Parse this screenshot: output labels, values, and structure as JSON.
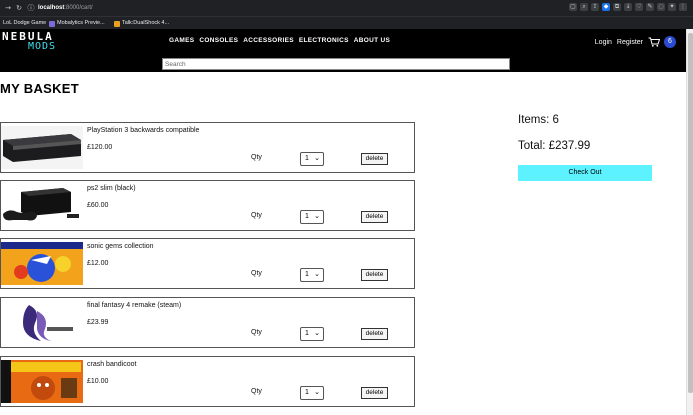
{
  "browser": {
    "url_host": "localhost",
    "url_path": ":8000/cart/",
    "bookmarks": [
      {
        "label": "LoL Dodge Game",
        "icon": "bookmark-icon"
      },
      {
        "label": "Mobalytics Previe...",
        "icon": "shield-icon"
      },
      {
        "label": "Talk:DualShock 4...",
        "icon": "wiki-icon"
      }
    ]
  },
  "site": {
    "logo_top": "NEBULA",
    "logo_bottom": "MODS",
    "nav": [
      "GAMES",
      "CONSOLES",
      "ACCESSORIES",
      "ELECTRONICS",
      "ABOUT US"
    ],
    "login": "Login",
    "register": "Register",
    "cart_count": "6",
    "search_placeholder": "Search",
    "accent": "#5cf2ff"
  },
  "basket": {
    "title": "MY BASKET",
    "qty_label": "Qty",
    "delete_label": "delete",
    "items": [
      {
        "name": "PlayStation 3 backwards compatible",
        "price": "£120.00",
        "qty": "1"
      },
      {
        "name": "ps2 slim (black)",
        "price": "£60.00",
        "qty": "1"
      },
      {
        "name": "sonic gems collection",
        "price": "£12.00",
        "qty": "1"
      },
      {
        "name": "final fantasy 4 remake (steam)",
        "price": "£23.99",
        "qty": "1"
      },
      {
        "name": "crash bandicoot",
        "price": "£10.00",
        "qty": "1"
      }
    ]
  },
  "summary": {
    "items_text": "Items: 6",
    "total_text": "Total: £237.99",
    "checkout_label": "Check Out"
  }
}
